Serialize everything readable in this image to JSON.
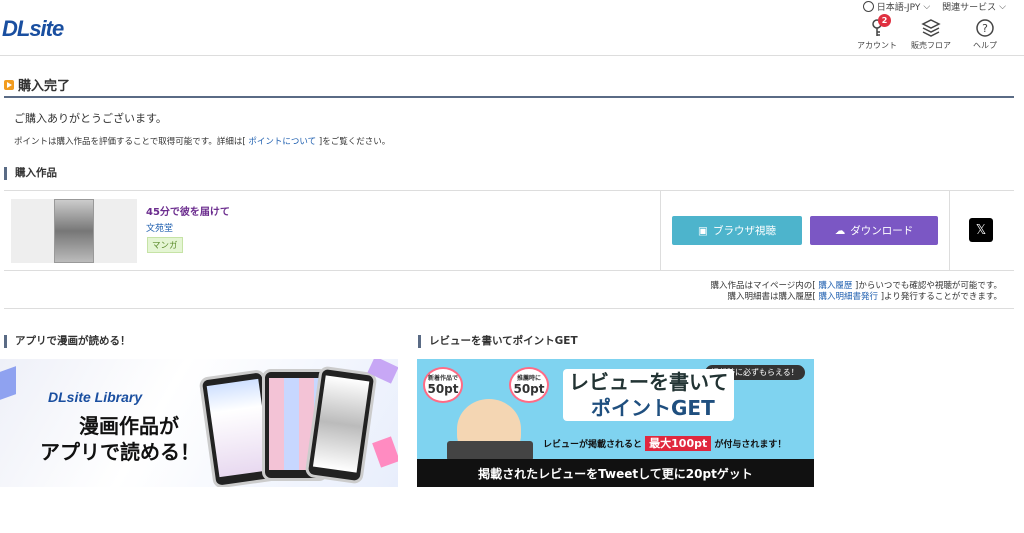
{
  "header": {
    "logo": "DLsite",
    "lang": "日本語-JPY",
    "related": "関連サービス",
    "account_label": "アカウント",
    "account_badge": "2",
    "floor_label": "販売フロア",
    "help_label": "ヘルプ"
  },
  "page": {
    "title": "購入完了",
    "thanks": "ご購入ありがとうございます。",
    "point_note_pre": "ポイントは購入作品を評価することで取得可能です。詳細は[",
    "point_link": "ポイントについて",
    "point_note_post": "]をご覧ください。"
  },
  "works": {
    "section_title": "購入作品",
    "title": "45分で彼を届けて",
    "circle": "文苑堂",
    "tag": "マンガ",
    "browser_btn": "ブラウザ視聴",
    "download_btn": "ダウンロード",
    "x_icon": "𝕏"
  },
  "help": {
    "l1_pre": "購入作品はマイページ内の[",
    "l1_link": "購入履歴",
    "l1_post": "]からいつでも確認や視聴が可能です。",
    "l2_pre": "購入明細書は購入履歴[",
    "l2_link": "購入明細書発行",
    "l2_post": "]より発行することができます。"
  },
  "app_banner": {
    "section_title": "アプリで漫画が読める！",
    "brand": "DLsite Library",
    "line1": "漫画作品が",
    "line2": "アプリで読める！"
  },
  "review_banner": {
    "section_title": "レビューを書いてポイントGET",
    "bubble1_top": "新着作品で",
    "bubble1_val": "50pt",
    "bubble2_top": "推薦時に",
    "bubble2_val": "50pt",
    "heading1": "レビューを書いて",
    "heading2": "ポイントGET",
    "sub": "掲載時に必ずもらえる！",
    "desc_pre": "レビューが掲載されると",
    "desc_hl": "最大100pt",
    "desc_post": "が付与されます！",
    "footer": "掲載されたレビューをTweetして更に20ptゲット"
  }
}
